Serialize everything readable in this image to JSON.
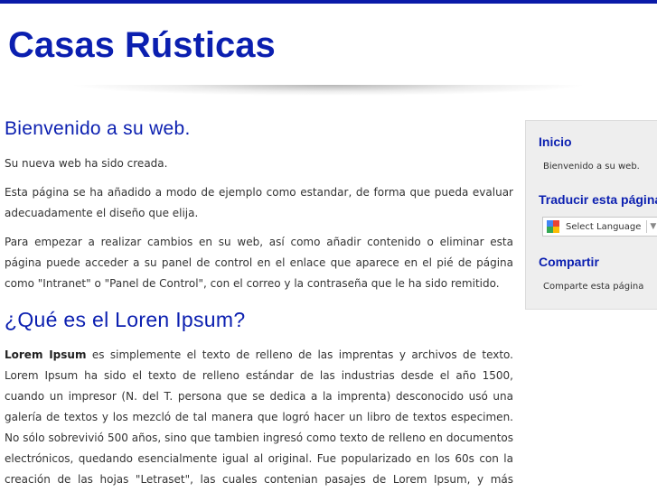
{
  "header": {
    "site_title": "Casas Rústicas"
  },
  "main": {
    "welcome_heading": "Bienvenido a su web.",
    "intro": "Su nueva web ha sido creada.",
    "paragraph_example": "Esta página se ha añadido a modo de ejemplo como estandar, de forma que pueda evaluar adecuadamente el diseño que elija.",
    "paragraph_changes": "Para empezar a realizar cambios en su web, así como añadir contenido o eliminar esta página puede acceder a su panel de control en el enlace que aparece en el pié de página como \"Intranet\" o \"Panel de Control\", con el correo y la contraseña que le ha sido remitido.",
    "lorem_heading": "¿Qué es el Loren Ipsum?",
    "lorem_bold": "Lorem Ipsum",
    "lorem_text": " es simplemente el texto de relleno de las imprentas y archivos de texto. Lorem Ipsum ha sido el texto de relleno estándar de las industrias desde el año 1500, cuando un impresor (N. del T. persona que se dedica a la imprenta) desconocido usó una galería de textos y los mezcló de tal manera que logró hacer un libro de textos especimen. No sólo sobrevivió 500 años, sino que tambien ingresó como texto de relleno en documentos electrónicos, quedando esencialmente igual al original. Fue popularizado en los 60s con la creación de las hojas \"Letraset\", las cuales contenian pasajes de Lorem Ipsum, y más recientemente con software de"
  },
  "sidebar": {
    "inicio_heading": "Inicio",
    "inicio_link": "Bienvenido a su web.",
    "translate_heading": "Traducir esta página",
    "language_select": "Select Language",
    "share_heading": "Compartir",
    "share_link": "Comparte esta página"
  },
  "colors": {
    "accent": "#0b1fb0",
    "top_bar": "#0a1aa8",
    "sidebar_bg": "#eeeeee"
  }
}
